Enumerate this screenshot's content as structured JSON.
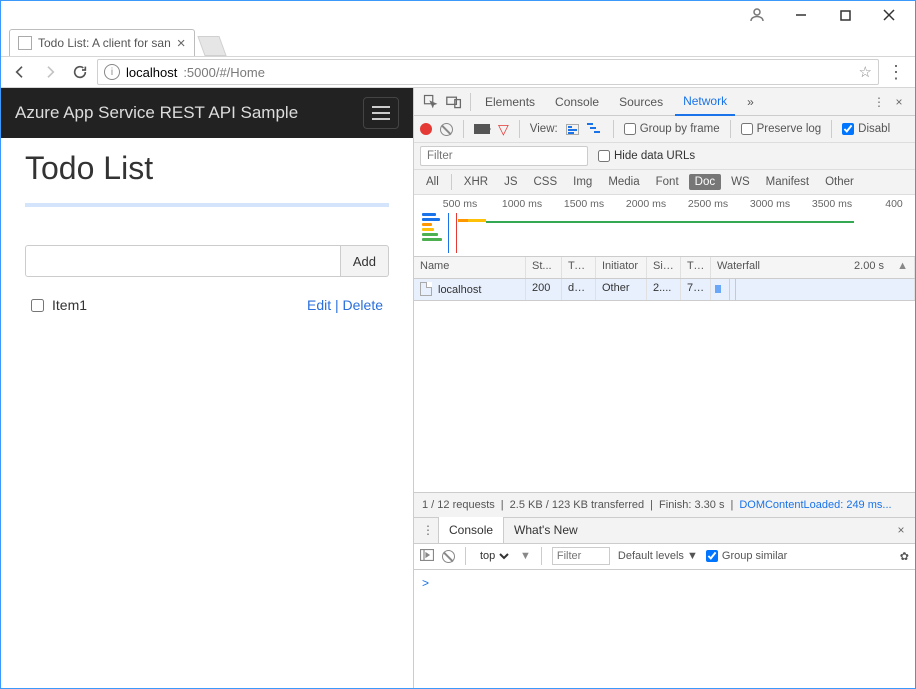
{
  "window": {
    "tab_title": "Todo List: A client for san"
  },
  "addressbar": {
    "host": "localhost",
    "port_path": ":5000/#/Home"
  },
  "app": {
    "navbar_title": "Azure App Service REST API Sample",
    "page_title": "Todo List",
    "add_button": "Add",
    "items": [
      {
        "name": "Item1",
        "edit": "Edit",
        "delete": "Delete"
      }
    ]
  },
  "devtools": {
    "panels": [
      "Elements",
      "Console",
      "Sources",
      "Network"
    ],
    "active_panel": "Network",
    "toolbar": {
      "view_label": "View:",
      "group_by_frame": "Group by frame",
      "preserve_log": "Preserve log",
      "disable_cache": "Disabl"
    },
    "filter": {
      "placeholder": "Filter",
      "hide_data_urls": "Hide data URLs"
    },
    "types": [
      "All",
      "XHR",
      "JS",
      "CSS",
      "Img",
      "Media",
      "Font",
      "Doc",
      "WS",
      "Manifest",
      "Other"
    ],
    "types_selected": "Doc",
    "timeline_labels": [
      "500 ms",
      "1000 ms",
      "1500 ms",
      "2000 ms",
      "2500 ms",
      "3000 ms",
      "3500 ms",
      "400"
    ],
    "columns": {
      "name": "Name",
      "status": "St...",
      "type": "Type",
      "initiator": "Initiator",
      "size": "Size",
      "time": "Ti...",
      "waterfall": "Waterfall",
      "wf_scale": "2.00 s"
    },
    "rows": [
      {
        "name": "localhost",
        "status": "200",
        "type": "do...",
        "initiator": "Other",
        "size": "2....",
        "time": "7 ..."
      }
    ],
    "statusbar": {
      "requests": "1 / 12 requests",
      "transferred": "2.5 KB / 123 KB transferred",
      "finish": "Finish: 3.30 s",
      "dcl": "DOMContentLoaded: 249 ms..."
    },
    "drawer": {
      "tabs": [
        "Console",
        "What's New"
      ],
      "active": "Console",
      "context": "top",
      "filter_placeholder": "Filter",
      "levels": "Default levels",
      "group_similar": "Group similar",
      "prompt": ">"
    }
  }
}
